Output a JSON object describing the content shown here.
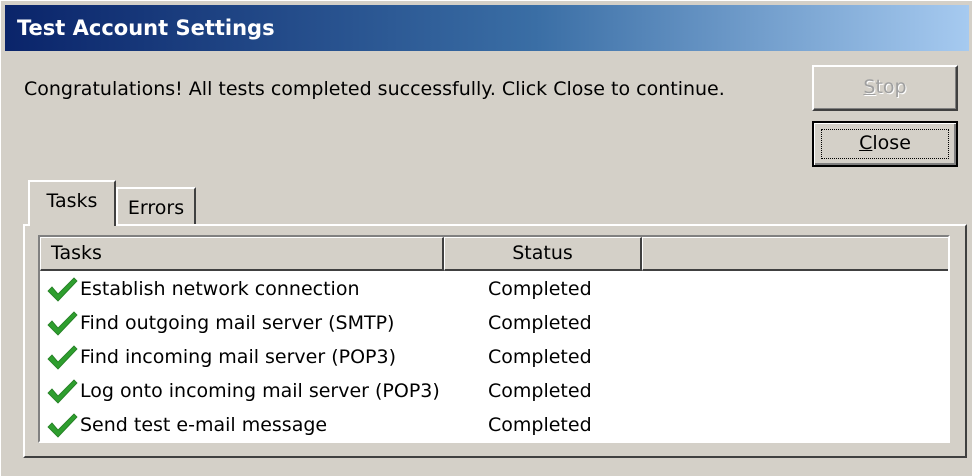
{
  "window": {
    "title": "Test Account Settings",
    "message": "Congratulations! All tests completed successfully. Click Close to continue."
  },
  "buttons": {
    "stop": {
      "label_prefix": "",
      "mnemonic": "S",
      "label_rest": "top",
      "enabled": false
    },
    "close": {
      "label_prefix": "",
      "mnemonic": "C",
      "label_rest": "lose",
      "enabled": true
    }
  },
  "tabs": [
    {
      "label": "Tasks",
      "selected": true
    },
    {
      "label": "Errors",
      "selected": false
    }
  ],
  "table": {
    "columns": [
      "Tasks",
      "Status",
      ""
    ],
    "rows": [
      {
        "task": "Establish network connection",
        "status": "Completed",
        "icon": "checkmark-icon"
      },
      {
        "task": "Find outgoing mail server (SMTP)",
        "status": "Completed",
        "icon": "checkmark-icon"
      },
      {
        "task": "Find incoming mail server (POP3)",
        "status": "Completed",
        "icon": "checkmark-icon"
      },
      {
        "task": "Log onto incoming mail server (POP3)",
        "status": "Completed",
        "icon": "checkmark-icon"
      },
      {
        "task": "Send test e-mail message",
        "status": "Completed",
        "icon": "checkmark-icon"
      }
    ]
  },
  "colors": {
    "titlebar_start": "#0a246a",
    "titlebar_end": "#a6caf0",
    "face": "#d4d0c8",
    "check": "#2e9e2e"
  }
}
